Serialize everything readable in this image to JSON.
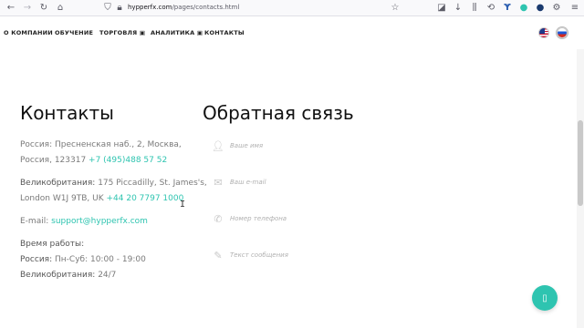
{
  "browser": {
    "url_domain": "hypperfx.com",
    "url_path": "/pages/contacts.html"
  },
  "nav": {
    "items": [
      "О КОМПАНИИ",
      "ОБУЧЕНИЕ",
      "ТОРГОВЛЯ",
      "АНАЛИТИКА",
      "КОНТАКТЫ"
    ]
  },
  "contacts": {
    "title": "Контакты",
    "russia_label": "Россия:",
    "russia_addr_1": "Пресненская наб., 2, Москва,",
    "russia_addr_2_label": "Россия, 123317",
    "russia_phone": "+7 (495)488 57 52",
    "uk_label": "Великобритания:",
    "uk_addr_1": "175 Piccadilly, St. James's,",
    "uk_addr_2": "London W1J 9TB, UK",
    "uk_phone": "+44 20 7797 1000",
    "email_label": "E-mail:",
    "email": "support@hypperfx.com",
    "hours_title": "Время работы:",
    "hours_russia_label": "Россия:",
    "hours_russia": "Пн-Суб: 10:00 - 19:00",
    "hours_uk_label": "Великобритания:",
    "hours_uk": "24/7"
  },
  "form": {
    "title": "Обратная связь",
    "name_placeholder": "Ваше имя",
    "email_placeholder": "Ваш e-mail",
    "phone_placeholder": "Номер телефона",
    "message_placeholder": "Текст сообщения"
  },
  "colors": {
    "accent": "#2ec4b0"
  }
}
